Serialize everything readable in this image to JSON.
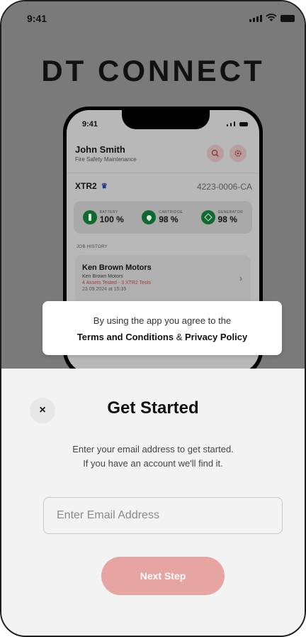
{
  "status_bar": {
    "time": "9:41"
  },
  "brand": {
    "title": "DT CONNECT"
  },
  "preview": {
    "time": "9:41",
    "user_name": "John Smith",
    "user_role": "Fire Safety Maintenance",
    "device_name": "XTR2",
    "device_serial": "4223-0006-CA",
    "stats": [
      {
        "label": "BATTERY",
        "value": "100 %"
      },
      {
        "label": "CARTRIDGE",
        "value": "98 %"
      },
      {
        "label": "GENERATOR",
        "value": "98 %"
      }
    ],
    "history_label": "JOB HISTORY",
    "job": {
      "title": "Ken Brown Motors",
      "subtitle": "Ken Brown Motors",
      "tests": "4 Assets Tested - 3 XTR2 Tests",
      "date": "23.09.2024 at 15:35"
    }
  },
  "terms": {
    "line1": "By using the app you agree to the",
    "terms_link": "Terms and Conditions",
    "ampersand": "&",
    "privacy_link": "Privacy Policy"
  },
  "sheet": {
    "close_symbol": "×",
    "title": "Get Started",
    "desc_line1": "Enter your email address to get started.",
    "desc_line2": "If you have an account we'll find it.",
    "email_placeholder": "Enter Email Address",
    "next_label": "Next Step"
  },
  "colors": {
    "accent": "#e6a5a0",
    "stat_green": "#0f6a2f",
    "overlay": "#7a7a7a"
  }
}
